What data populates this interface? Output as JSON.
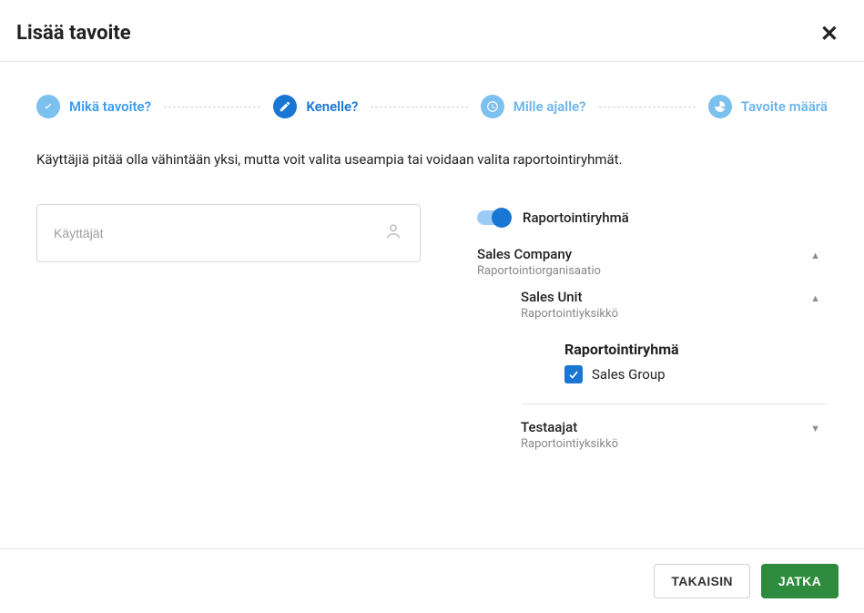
{
  "header": {
    "title": "Lisää tavoite"
  },
  "steps": [
    {
      "label": "Mikä tavoite?"
    },
    {
      "label": "Kenelle?"
    },
    {
      "label": "Mille ajalle?"
    },
    {
      "label": "Tavoite määrä"
    }
  ],
  "description": "Käyttäjiä pitää olla vähintään yksi, mutta voit valita useampia tai voidaan valita raportointiryhmät.",
  "userInput": {
    "placeholder": "Käyttäjät"
  },
  "toggle": {
    "label": "Raportointiryhmä"
  },
  "tree": {
    "org": {
      "title": "Sales Company",
      "subtitle": "Raportointiorganisaatio"
    },
    "unit1": {
      "title": "Sales Unit",
      "subtitle": "Raportointiyksikkö"
    },
    "groupHeader": "Raportointiryhmä",
    "group": {
      "label": "Sales Group"
    },
    "unit2": {
      "title": "Testaajat",
      "subtitle": "Raportointiyksikkö"
    }
  },
  "footer": {
    "back": "TAKAISIN",
    "continue": "JATKA"
  }
}
